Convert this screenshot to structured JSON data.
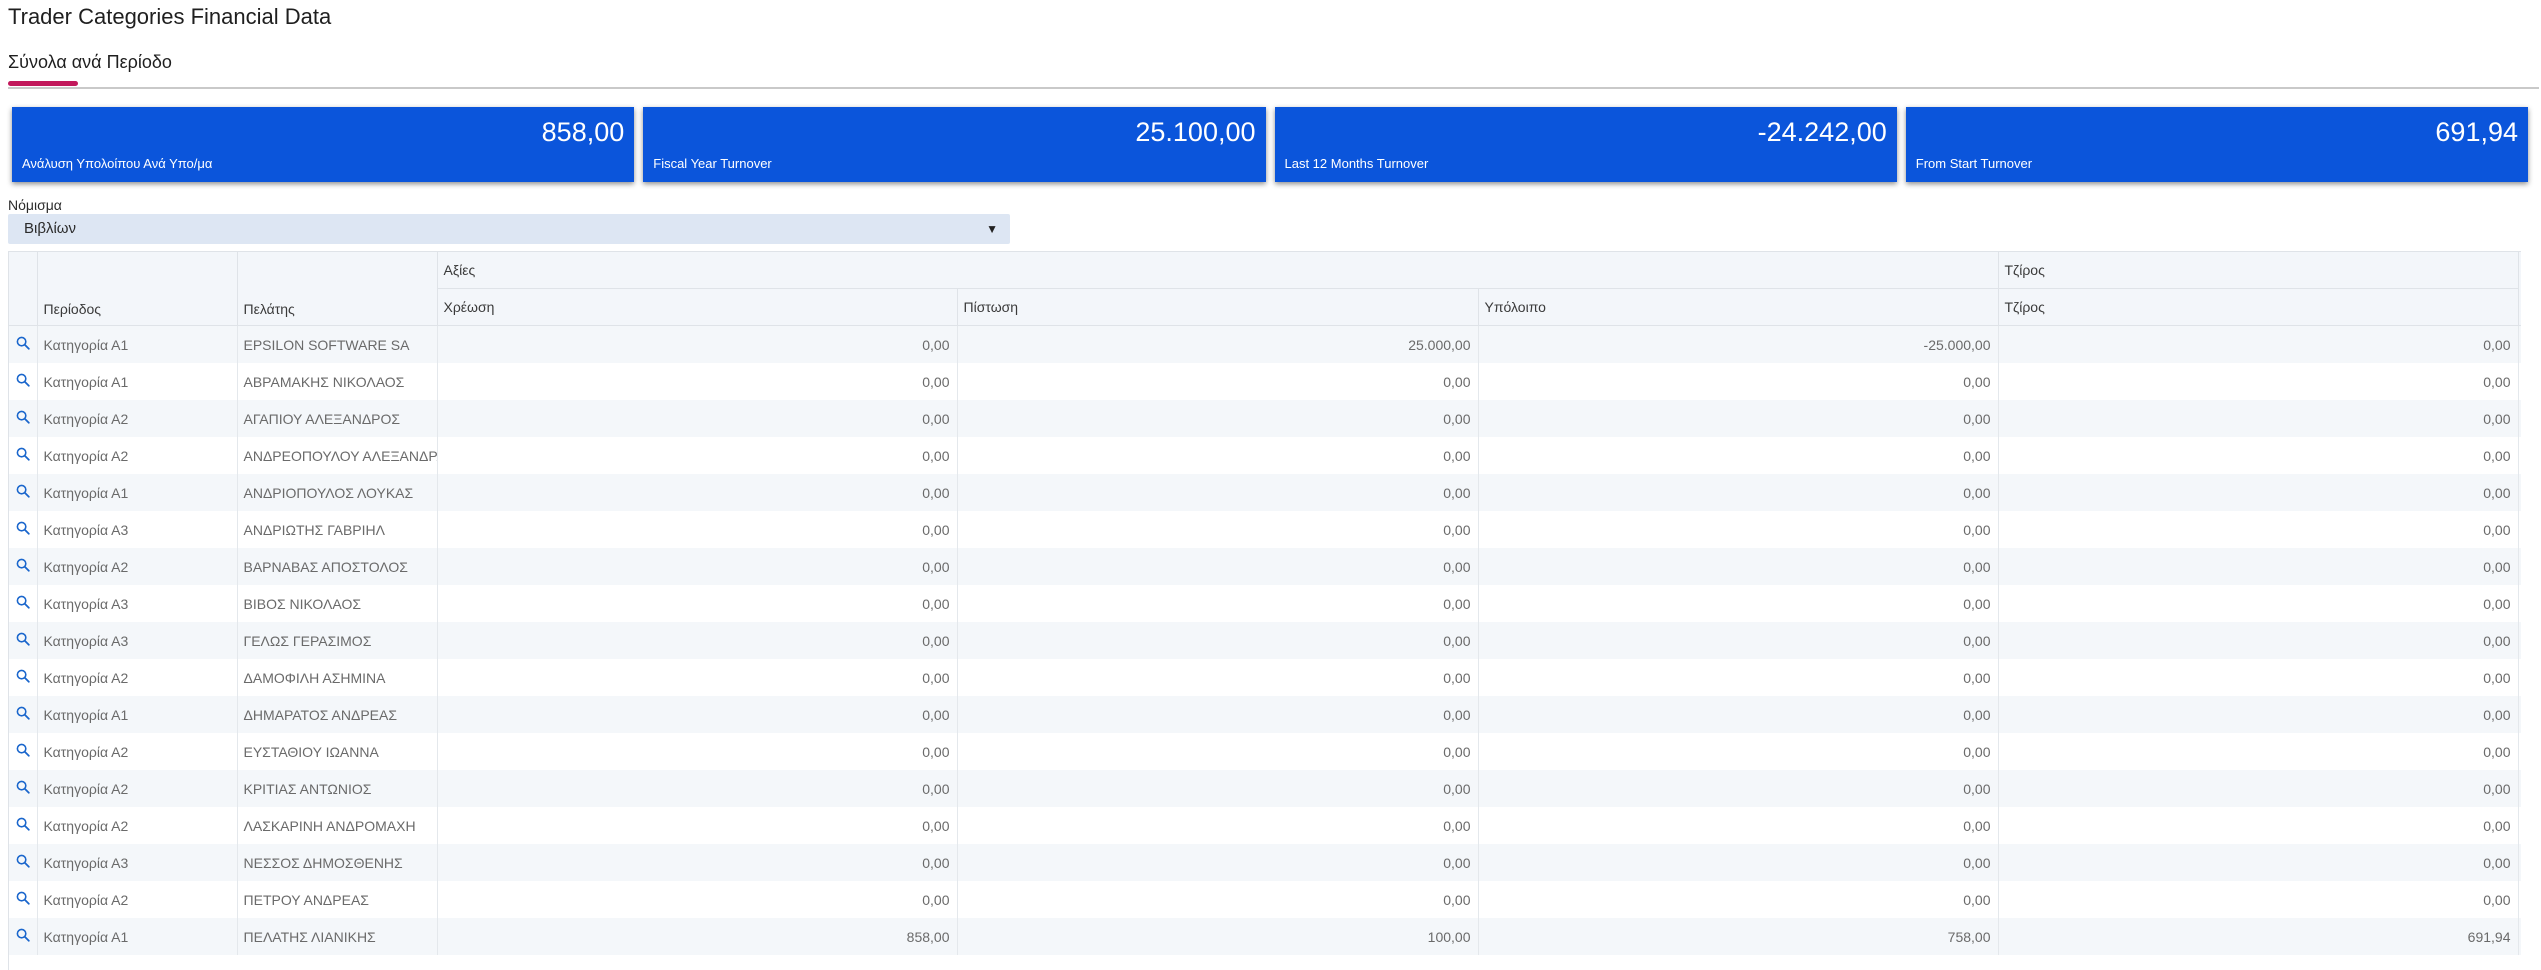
{
  "page": {
    "title": "Trader Categories Financial Data"
  },
  "tabs": [
    {
      "label": "Σύνολα ανά Περίοδο",
      "active": true
    }
  ],
  "colors": {
    "accent": "#0b55db",
    "tab_indicator": "#c2185b",
    "icon": "#1a66cc"
  },
  "summary_cards": [
    {
      "value": "858,00",
      "label": "Ανάλυση Υπολοίπου Ανά Υπο/μα"
    },
    {
      "value": "25.100,00",
      "label": "Fiscal Year Turnover"
    },
    {
      "value": "-24.242,00",
      "label": "Last 12 Months Turnover"
    },
    {
      "value": "691,94",
      "label": "From Start Turnover"
    }
  ],
  "currency": {
    "label": "Νόμισμα",
    "value": "Βιβλίων"
  },
  "grid": {
    "group_headers": {
      "values": "Αξίες",
      "turnover": "Τζίρος"
    },
    "columns": {
      "period": "Περίοδος",
      "customer": "Πελάτης",
      "debit": "Χρέωση",
      "credit": "Πίστωση",
      "balance": "Υπόλοιπο",
      "turnover": "Τζίρος"
    },
    "row_icon": "search-icon",
    "rows": [
      {
        "period": "Κατηγορία Α1",
        "customer": "EPSILON SOFTWARE SA",
        "debit": "0,00",
        "credit": "25.000,00",
        "balance": "-25.000,00",
        "turnover": "0,00"
      },
      {
        "period": "Κατηγορία Α1",
        "customer": "ΑΒΡΑΜΑΚΗΣ ΝΙΚΟΛΑΟΣ",
        "debit": "0,00",
        "credit": "0,00",
        "balance": "0,00",
        "turnover": "0,00"
      },
      {
        "period": "Κατηγορία Α2",
        "customer": "ΑΓΑΠΙΟΥ ΑΛΕΞΑΝΔΡΟΣ",
        "debit": "0,00",
        "credit": "0,00",
        "balance": "0,00",
        "turnover": "0,00"
      },
      {
        "period": "Κατηγορία Α2",
        "customer": "ΑΝΔΡΕΟΠΟΥΛΟΥ ΑΛΕΞΑΝΔΡΑ",
        "debit": "0,00",
        "credit": "0,00",
        "balance": "0,00",
        "turnover": "0,00"
      },
      {
        "period": "Κατηγορία Α1",
        "customer": "ΑΝΔΡΙΟΠΟΥΛΟΣ ΛΟΥΚΑΣ",
        "debit": "0,00",
        "credit": "0,00",
        "balance": "0,00",
        "turnover": "0,00"
      },
      {
        "period": "Κατηγορία Α3",
        "customer": "ΑΝΔΡΙΩΤΗΣ ΓΑΒΡΙΗΛ",
        "debit": "0,00",
        "credit": "0,00",
        "balance": "0,00",
        "turnover": "0,00"
      },
      {
        "period": "Κατηγορία Α2",
        "customer": "ΒΑΡΝΑΒΑΣ ΑΠΟΣΤΟΛΟΣ",
        "debit": "0,00",
        "credit": "0,00",
        "balance": "0,00",
        "turnover": "0,00"
      },
      {
        "period": "Κατηγορία Α3",
        "customer": "ΒΙΒΟΣ ΝΙΚΟΛΑΟΣ",
        "debit": "0,00",
        "credit": "0,00",
        "balance": "0,00",
        "turnover": "0,00"
      },
      {
        "period": "Κατηγορία Α3",
        "customer": "ΓΕΛΩΣ ΓΕΡΑΣΙΜΟΣ",
        "debit": "0,00",
        "credit": "0,00",
        "balance": "0,00",
        "turnover": "0,00"
      },
      {
        "period": "Κατηγορία Α2",
        "customer": "ΔΑΜΟΦΙΛΗ ΑΣΗΜΙΝΑ",
        "debit": "0,00",
        "credit": "0,00",
        "balance": "0,00",
        "turnover": "0,00"
      },
      {
        "period": "Κατηγορία Α1",
        "customer": "ΔΗΜΑΡΑΤΟΣ ΑΝΔΡΕΑΣ",
        "debit": "0,00",
        "credit": "0,00",
        "balance": "0,00",
        "turnover": "0,00"
      },
      {
        "period": "Κατηγορία Α2",
        "customer": "ΕΥΣΤΑΘΙΟΥ ΙΩΑΝΝΑ",
        "debit": "0,00",
        "credit": "0,00",
        "balance": "0,00",
        "turnover": "0,00"
      },
      {
        "period": "Κατηγορία Α2",
        "customer": "ΚΡΙΤΙΑΣ ΑΝΤΩΝΙΟΣ",
        "debit": "0,00",
        "credit": "0,00",
        "balance": "0,00",
        "turnover": "0,00"
      },
      {
        "period": "Κατηγορία Α2",
        "customer": "ΛΑΣΚΑΡΙΝΗ ΑΝΔΡΟΜΑΧΗ",
        "debit": "0,00",
        "credit": "0,00",
        "balance": "0,00",
        "turnover": "0,00"
      },
      {
        "period": "Κατηγορία Α3",
        "customer": "ΝΕΣΣΟΣ ΔΗΜΟΣΘΕΝΗΣ",
        "debit": "0,00",
        "credit": "0,00",
        "balance": "0,00",
        "turnover": "0,00"
      },
      {
        "period": "Κατηγορία Α2",
        "customer": "ΠΕΤΡΟΥ ΑΝΔΡΕΑΣ",
        "debit": "0,00",
        "credit": "0,00",
        "balance": "0,00",
        "turnover": "0,00"
      },
      {
        "period": "Κατηγορία Α1",
        "customer": "ΠΕΛΑΤΗΣ ΛΙΑΝΙΚΗΣ",
        "debit": "858,00",
        "credit": "100,00",
        "balance": "758,00",
        "turnover": "691,94"
      }
    ]
  }
}
